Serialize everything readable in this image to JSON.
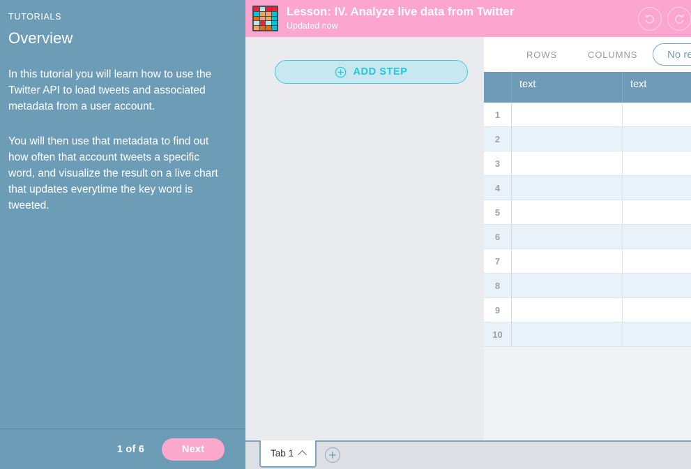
{
  "tutorial": {
    "eyebrow": "TUTORIALS",
    "title": "Overview",
    "paragraphs": [
      "In this tutorial you will learn how to use the Twitter API to load tweets and associated metadata from a user account.",
      "You will then use that metadata to find out how often that account tweets a specific word, and visualize the result on a live chart that updates everytime the key word is tweeted."
    ],
    "page_counter": "1 of 6",
    "next_label": "Next",
    "background_color": "#6C9CB6",
    "next_button_color": "#FBA8CD"
  },
  "header": {
    "title": "Lesson: IV. Analyze live data from Twitter",
    "subtitle": "Updated now",
    "background_color": "#FCA5CE",
    "undo_icon": "undo-icon",
    "redo_icon": "redo-icon",
    "app_icon": "grid-app-icon",
    "icon_cells": [
      "#E8243C",
      "#B8E6E6",
      "#E8243C",
      "#E8243C",
      "#00C4D6",
      "#F5A25D",
      "#F5A25D",
      "#00C4D6",
      "#ED6A00",
      "#F5A25D",
      "#F5A25D",
      "#00C4D6",
      "#B8E6E6",
      "#E8243C",
      "#B8E6E6",
      "#00C4D6",
      "#F5A25D",
      "#ED6A00",
      "#ED6A00",
      "#00C4D6"
    ]
  },
  "steps_panel": {
    "add_step_label": "ADD STEP",
    "add_step_icon": "plus-circle-icon",
    "accent_color": "#21C8DE",
    "background_color": "#E9EBEE"
  },
  "data_panel": {
    "tabs": [
      {
        "id": "rows",
        "label": "ROWS"
      },
      {
        "id": "columns",
        "label": "COLUMNS"
      }
    ],
    "filter_pill_label": "No results",
    "table": {
      "columns": [
        {
          "label": "text",
          "type": "text"
        },
        {
          "label": "text",
          "type": "text"
        }
      ],
      "row_numbers": [
        "1",
        "2",
        "3",
        "4",
        "5",
        "6",
        "7",
        "8",
        "9",
        "10"
      ],
      "rows": [
        [
          "",
          ""
        ],
        [
          "",
          ""
        ],
        [
          "",
          ""
        ],
        [
          "",
          ""
        ],
        [
          "",
          ""
        ],
        [
          "",
          ""
        ],
        [
          "",
          ""
        ],
        [
          "",
          ""
        ],
        [
          "",
          ""
        ],
        [
          "",
          ""
        ]
      ],
      "header_color": "#6F9BB8",
      "stripe_color": "#EAF2F9"
    }
  },
  "tab_bar": {
    "sheet_tab_label": "Tab 1",
    "sheet_tab_chevron": "chevron-up-icon",
    "add_tab_icon": "plus-circle-icon"
  }
}
